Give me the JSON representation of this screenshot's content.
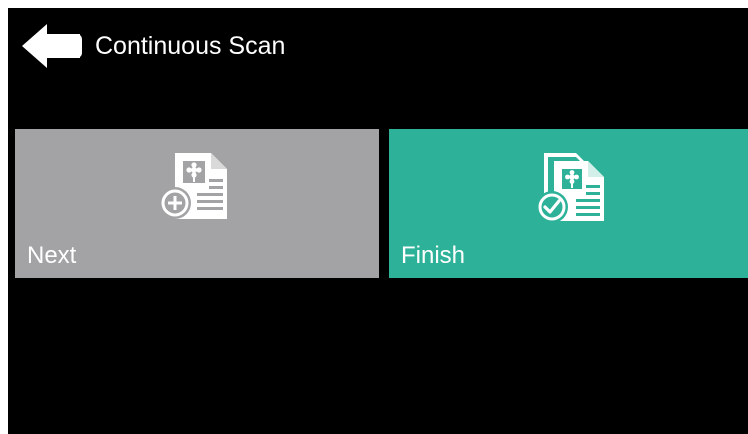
{
  "header": {
    "title": "Continuous Scan",
    "back_icon": "back-arrow-icon"
  },
  "tiles": [
    {
      "label": "Next",
      "icon": "add-page-icon",
      "color": "#a3a2a4"
    },
    {
      "label": "Finish",
      "icon": "finish-scan-icon",
      "color": "#2db299"
    }
  ],
  "colors": {
    "background": "#000000",
    "text": "#ffffff"
  }
}
